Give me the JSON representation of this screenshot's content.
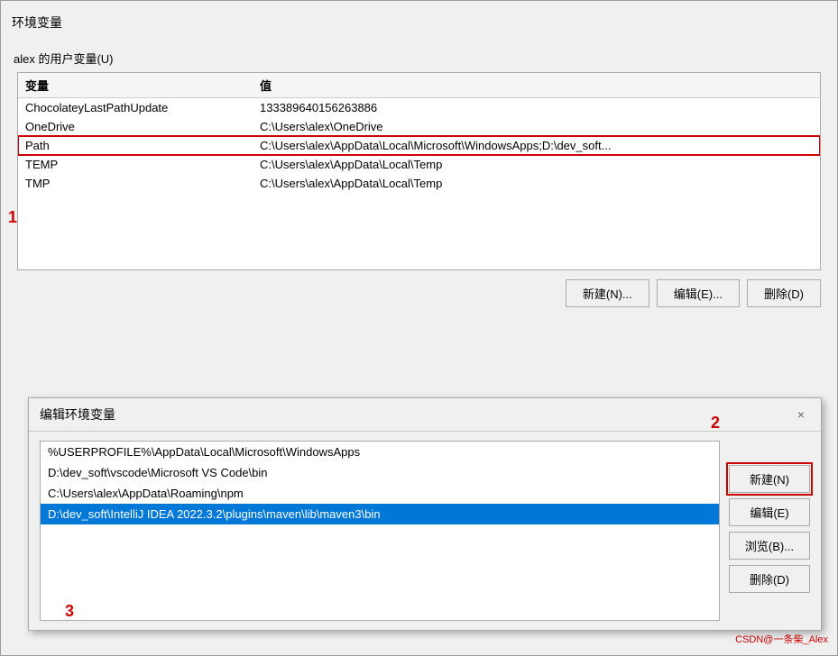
{
  "dialog": {
    "title": "环境变量",
    "user_section_label": "alex 的用户变量(U)",
    "table": {
      "col_var": "变量",
      "col_val": "值",
      "rows": [
        {
          "var": "ChocolateyLastPathUpdate",
          "val": "133389640156263886",
          "selected": false
        },
        {
          "var": "OneDrive",
          "val": "C:\\Users\\alex\\OneDrive",
          "selected": false
        },
        {
          "var": "Path",
          "val": "C:\\Users\\alex\\AppData\\Local\\Microsoft\\WindowsApps;D:\\dev_soft...",
          "selected": true
        },
        {
          "var": "TEMP",
          "val": "C:\\Users\\alex\\AppData\\Local\\Temp",
          "selected": false
        },
        {
          "var": "TMP",
          "val": "C:\\Users\\alex\\AppData\\Local\\Temp",
          "selected": false
        }
      ]
    },
    "buttons": {
      "new": "新建(N)...",
      "edit": "编辑(E)...",
      "delete": "删除(D)"
    }
  },
  "edit_dialog": {
    "title": "编辑环境变量",
    "close_icon": "×",
    "paths": [
      {
        "val": "%USERPROFILE%\\AppData\\Local\\Microsoft\\WindowsApps",
        "selected": false
      },
      {
        "val": "D:\\dev_soft\\vscode\\Microsoft VS Code\\bin",
        "selected": false
      },
      {
        "val": "C:\\Users\\alex\\AppData\\Roaming\\npm",
        "selected": false
      },
      {
        "val": "D:\\dev_soft\\IntelliJ IDEA 2022.3.2\\plugins\\maven\\lib\\maven3\\bin",
        "selected": true
      }
    ],
    "buttons": {
      "new": "新建(N)",
      "edit": "编辑(E)",
      "browse": "浏览(B)...",
      "delete": "删除(D)"
    }
  },
  "annotations": {
    "one": "1",
    "two": "2",
    "three": "3"
  },
  "watermark": "CSDN@一条柴_Alex"
}
